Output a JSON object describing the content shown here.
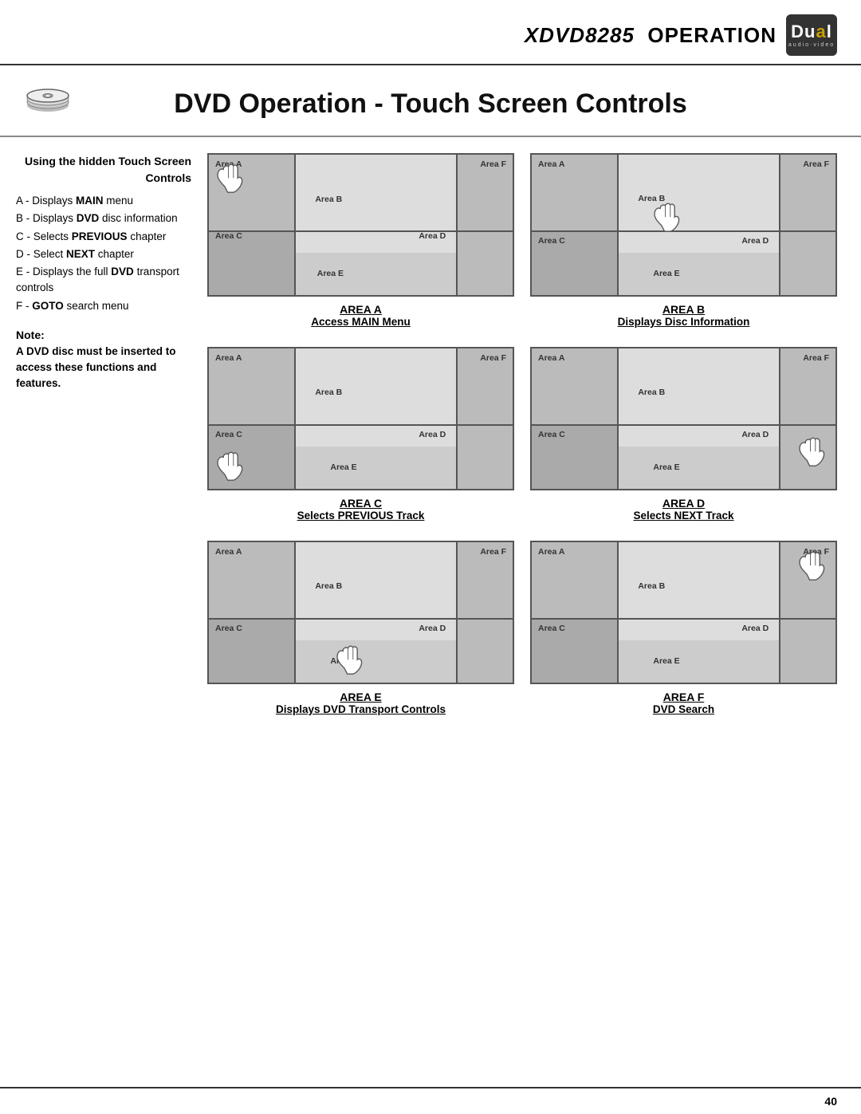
{
  "header": {
    "model": "XDVD8285",
    "operation": "OPERATION",
    "logo_text": "Dual",
    "logo_sub": "audio·video",
    "reg_symbol": "®"
  },
  "page_title": "DVD Operation - Touch Screen Controls",
  "dvd_icon_alt": "DVD disc",
  "sidebar": {
    "title_line1": "Using the hidden Touch Screen",
    "title_line2": "Controls",
    "items": [
      {
        "label": "A - Displays MAIN menu"
      },
      {
        "label": "B - Displays DVD disc information"
      },
      {
        "label": "C - Selects PREVIOUS chapter"
      },
      {
        "label": "D - Select NEXT chapter"
      },
      {
        "label": "E - Displays the full DVD transport controls"
      },
      {
        "label": "F - GOTO search menu"
      }
    ],
    "note_title": "Note:",
    "note_body": "A DVD disc must be inserted to access these functions and features."
  },
  "diagrams": [
    {
      "id": "area-a",
      "caption_area": "AREA A",
      "caption_desc": "Access MAIN Menu",
      "hand_position": "top-left",
      "highlight": "A"
    },
    {
      "id": "area-b",
      "caption_area": "AREA B",
      "caption_desc": "Displays Disc Information",
      "hand_position": "mid-center-top",
      "highlight": "B"
    },
    {
      "id": "area-c",
      "caption_area": "AREA C",
      "caption_desc": "Selects PREVIOUS Track",
      "hand_position": "bot-left",
      "highlight": "C"
    },
    {
      "id": "area-d",
      "caption_area": "AREA D",
      "caption_desc": "Selects NEXT Track",
      "hand_position": "mid-right",
      "highlight": "D"
    },
    {
      "id": "area-e",
      "caption_area": "AREA E",
      "caption_desc": "Displays DVD Transport Controls",
      "hand_position": "bot-center",
      "highlight": "E"
    },
    {
      "id": "area-f",
      "caption_area": "AREA F",
      "caption_desc": "DVD Search",
      "hand_position": "top-right",
      "highlight": "F"
    }
  ],
  "area_labels": {
    "a": "Area A",
    "b": "Area B",
    "c": "Area C",
    "d": "Area D",
    "e": "Area E",
    "f": "Area F"
  },
  "footer": {
    "page_number": "40"
  }
}
